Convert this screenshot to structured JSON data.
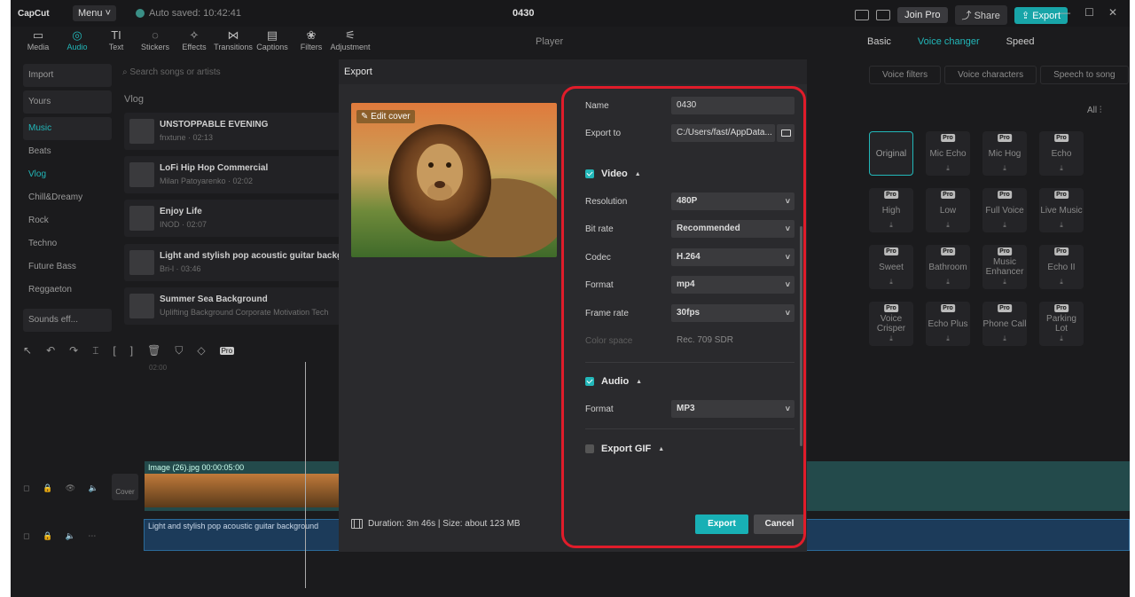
{
  "app": {
    "logo": "CapCut",
    "menu": "Menu",
    "autosave": "Auto saved: 10:42:41",
    "project_title": "0430"
  },
  "topbar": {
    "join_pro": "Join Pro",
    "share": "Share",
    "export": "Export"
  },
  "toolbar": [
    {
      "label": "Media",
      "icon": "▭"
    },
    {
      "label": "Audio",
      "icon": "◎"
    },
    {
      "label": "Text",
      "icon": "TI"
    },
    {
      "label": "Stickers",
      "icon": "◌"
    },
    {
      "label": "Effects",
      "icon": "✧"
    },
    {
      "label": "Transitions",
      "icon": "⋈"
    },
    {
      "label": "Captions",
      "icon": "▤"
    },
    {
      "label": "Filters",
      "icon": "❀"
    },
    {
      "label": "Adjustment",
      "icon": "⚟"
    }
  ],
  "sidebar": {
    "import": "Import",
    "yours": "Yours",
    "music": "Music",
    "items": [
      "Beats",
      "Vlog",
      "Chill&Dreamy",
      "Rock",
      "Techno",
      "Future Bass",
      "Reggaeton"
    ],
    "sound_effects": "Sounds eff..."
  },
  "library": {
    "search_placeholder": "Search songs or artists",
    "category": "Vlog",
    "songs": [
      {
        "title": "UNSTOPPABLE EVENING",
        "sub": "fnxtune · 02:13"
      },
      {
        "title": "LoFi Hip Hop Commercial",
        "sub": "Milan Patoyarenko · 02:02"
      },
      {
        "title": "Enjoy Life",
        "sub": "INOD · 02:07"
      },
      {
        "title": "Light and stylish pop acoustic guitar backg",
        "sub": "Bri-l · 03:46"
      },
      {
        "title": "Summer Sea Background",
        "sub": "Uplifting Background Corporate Motivation Tech"
      }
    ]
  },
  "player": {
    "label": "Player"
  },
  "right_panel": {
    "tabs": [
      "Basic",
      "Voice changer",
      "Speed"
    ],
    "subtabs": [
      "Voice filters",
      "Voice characters",
      "Speech to song"
    ],
    "all": "All",
    "voices": [
      "Original",
      "Mic Echo",
      "Mic Hog",
      "Echo",
      "High",
      "Low",
      "Full Voice",
      "Live Music",
      "Sweet",
      "Bathroom",
      "Music Enhancer",
      "Echo II",
      "Voice Crisper",
      "Echo Plus",
      "Phone Call",
      "Parking Lot"
    ]
  },
  "timeline": {
    "pro": "Pro",
    "track1_label": "Image (26).jpg  00:00:05:00",
    "track2_label": "Light and stylish pop acoustic guitar background",
    "cover": "Cover",
    "time_start": "02:00"
  },
  "export_dialog": {
    "title": "Export",
    "edit_cover": "Edit cover",
    "duration": "Duration: 3m 46s | Size: about 123 MB",
    "name_label": "Name",
    "name_value": "0430",
    "export_to_label": "Export to",
    "export_to_value": "C:/Users/fast/AppData...",
    "video_section": "Video",
    "resolution_label": "Resolution",
    "resolution_value": "480P",
    "bitrate_label": "Bit rate",
    "bitrate_value": "Recommended",
    "codec_label": "Codec",
    "codec_value": "H.264",
    "format_label": "Format",
    "format_value": "mp4",
    "framerate_label": "Frame rate",
    "framerate_value": "30fps",
    "colorspace_label": "Color space",
    "colorspace_value": "Rec. 709 SDR",
    "audio_section": "Audio",
    "audio_format_label": "Format",
    "audio_format_value": "MP3",
    "gif_section": "Export GIF",
    "export_button": "Export",
    "cancel_button": "Cancel",
    "video_checked": true,
    "audio_checked": true,
    "gif_checked": false
  },
  "colors": {
    "accent": "#22b7b9",
    "highlight": "#e01c2a",
    "dialog_bg": "#2a2a2d"
  }
}
